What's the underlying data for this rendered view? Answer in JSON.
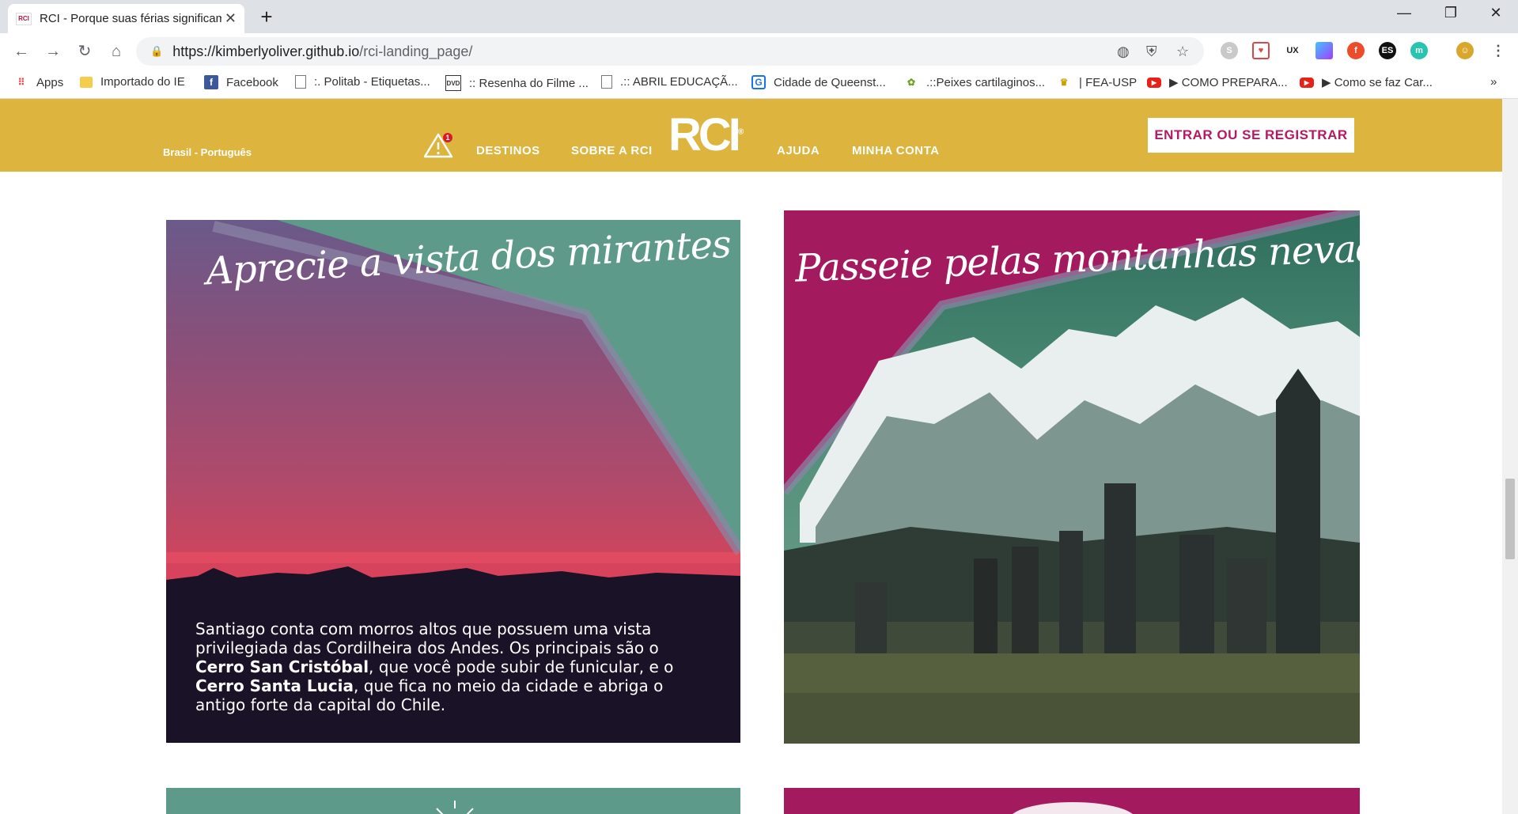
{
  "browser": {
    "tab_title": "RCI - Porque suas férias significam",
    "favicon_text": "RCI",
    "url_host": "https://kimberlyoliver.github.io",
    "url_path": "/rci-landing_page/",
    "extensions": [
      {
        "icon": "skype-icon",
        "color": "#c9c9c9"
      },
      {
        "icon": "pocket-icon",
        "color": "#e04545"
      },
      {
        "icon": "ux-icon",
        "color": "#222222"
      },
      {
        "icon": "gradient-icon",
        "color": "#7b5cff"
      },
      {
        "icon": "red-extension-icon",
        "color": "#ee4b2b"
      },
      {
        "icon": "es-icon",
        "color": "#111111",
        "text": "ES"
      },
      {
        "icon": "teal-extension-icon",
        "color": "#27c5b1"
      }
    ]
  },
  "bookmarks": [
    {
      "label": "Apps",
      "icon": "apps-grid-icon"
    },
    {
      "label": "Importado do IE",
      "icon": "folder-icon"
    },
    {
      "label": "Facebook",
      "icon": "facebook-icon"
    },
    {
      "label": ":. Politab - Etiquetas...",
      "icon": "page-icon"
    },
    {
      "label": ":: Resenha do Filme ...",
      "icon": "film-icon"
    },
    {
      "label": ".:: ABRIL EDUCAÇÃ...",
      "icon": "page-icon"
    },
    {
      "label": "Cidade de Queenst...",
      "icon": "g-icon"
    },
    {
      "label": ".::Peixes cartilaginos...",
      "icon": "fish-icon"
    },
    {
      "label": "| FEA-USP",
      "icon": "fea-icon"
    },
    {
      "label": "▶ COMO PREPARA...",
      "icon": "youtube-icon"
    },
    {
      "label": "▶ Como se faz Car...",
      "icon": "youtube-icon"
    }
  ],
  "site": {
    "language": "Brasil - Português",
    "alert_count": "1",
    "nav": {
      "destinos": "DESTINOS",
      "sobre": "SOBRE A RCI",
      "ajuda": "AJUDA",
      "minha_conta": "MINHA CONTA"
    },
    "logo": "RCI",
    "logo_mark": "®",
    "cta": "ENTRAR OU SE REGISTRAR",
    "colors": {
      "header": "#ddb43e",
      "teal": "#5e9a89",
      "magenta": "#a41a5f",
      "cta_text": "#b41a63"
    }
  },
  "cards": {
    "mirantes": {
      "title": "Aprecie a vista dos mirantes",
      "text_1": "Santiago conta com morros altos que possuem uma vista privilegiada das Cordilheira dos Andes. Os principais são o ",
      "bold_1": "Cerro San Cristóbal",
      "text_2": ", que você pode subir de funicular, e o ",
      "bold_2": "Cerro Santa Lucia",
      "text_3": ", que fica no meio da cidade e abriga o antigo forte da capital do Chile."
    },
    "montanhas": {
      "title": "Passeie pelas montanhas nevadas"
    }
  }
}
